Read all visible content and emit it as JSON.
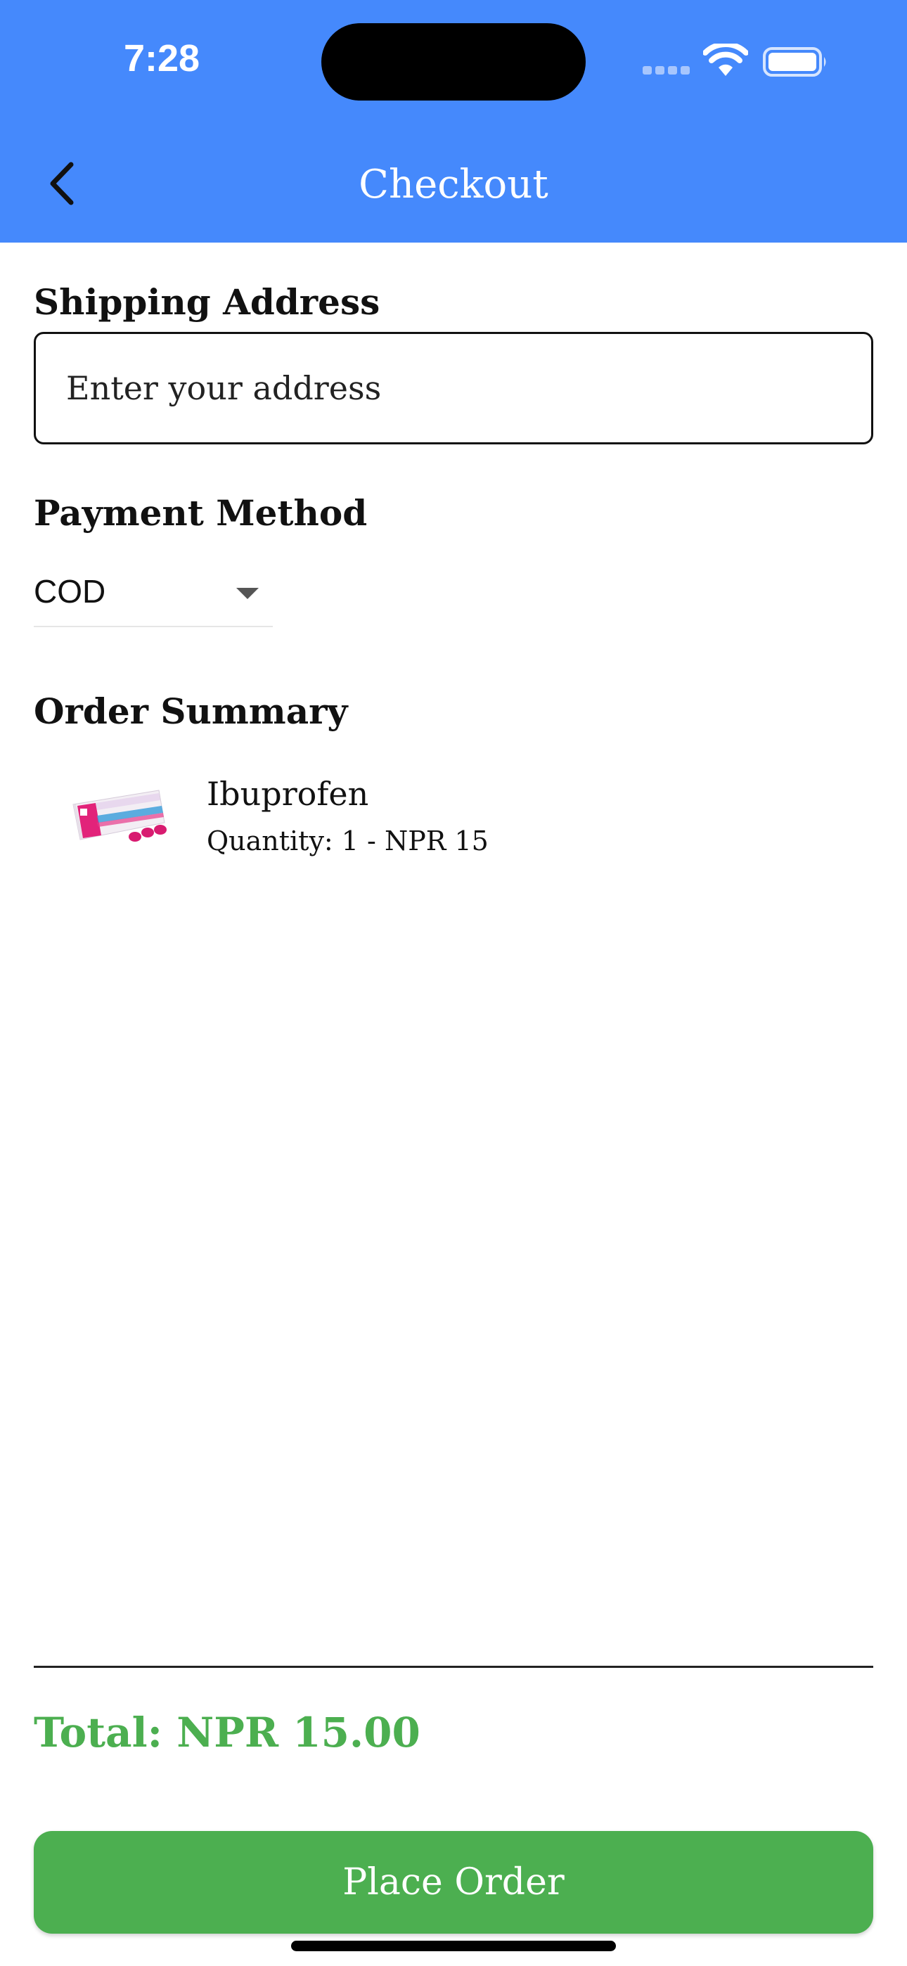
{
  "status_bar": {
    "time": "7:28"
  },
  "header": {
    "title": "Checkout",
    "background": "#4589fc"
  },
  "shipping": {
    "label": "Shipping Address",
    "placeholder": "Enter your address",
    "value": ""
  },
  "payment": {
    "label": "Payment Method",
    "selected": "COD"
  },
  "order_summary": {
    "label": "Order Summary",
    "items": [
      {
        "name": "Ibuprofen",
        "meta": "Quantity: 1 - NPR 15",
        "image_icon": "brufen-pack-image"
      }
    ]
  },
  "total": {
    "text": "Total: NPR 15.00",
    "color": "#4caf50"
  },
  "actions": {
    "place_order": "Place Order"
  }
}
